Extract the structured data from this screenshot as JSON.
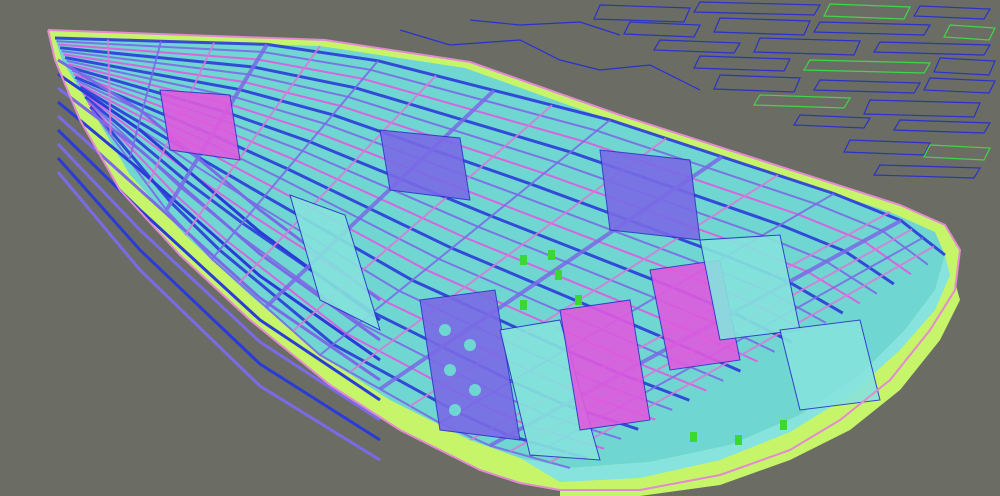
{
  "viewport": {
    "background": "#6b6d64",
    "colors": {
      "hull_plate": "#c6f56a",
      "hull_edge": "#e48ad2",
      "bulkhead": "#6fd6d2",
      "bulkhead_light": "#86e3dd",
      "stiffener_blue": "#2b3bd8",
      "stiffener_violet": "#7a6ae6",
      "web_magenta": "#e05adf",
      "web_pink": "#d97ad6",
      "bracket_green": "#39d833",
      "outline_blue": "#2a32c8",
      "outline_green": "#3fd64a"
    },
    "parts_panel_present": true
  }
}
